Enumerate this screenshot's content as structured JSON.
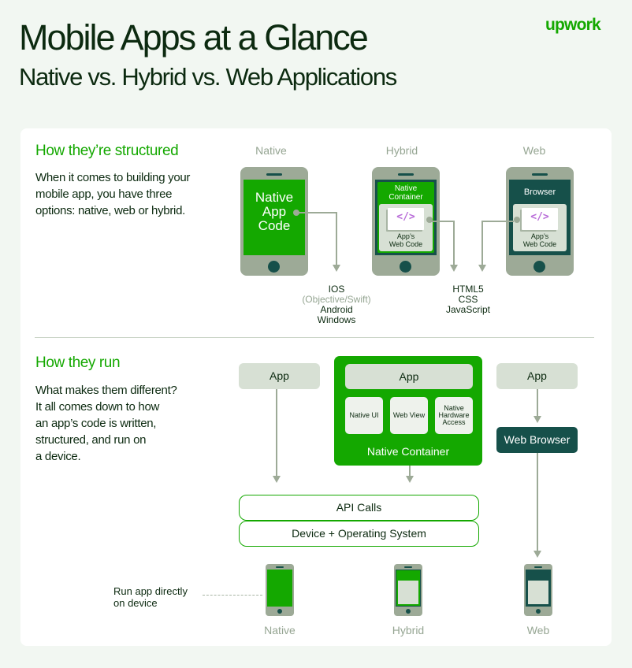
{
  "header": {
    "title": "Mobile Apps at a Glance",
    "subtitle": "Native vs. Hybrid vs. Web Applications",
    "logo": "upwork"
  },
  "colors": {
    "brand_green": "#14a800",
    "dark_teal": "#16504a",
    "phone_gray": "#9daa97",
    "light_gray": "#d7e0d4",
    "background": "#f2f7f2",
    "code_purple": "#b86bd8"
  },
  "structured": {
    "heading": "How they’re structured",
    "text_lines": [
      "When it comes to building your",
      "mobile app, you have three",
      "options: native, web or hybrid."
    ],
    "columns": [
      {
        "label": "Native",
        "screen_text": [
          "Native",
          "App",
          "Code"
        ],
        "icon": "phone-icon"
      },
      {
        "label": "Hybrid",
        "screen_text": [
          "Native",
          "Container"
        ],
        "code_label": [
          "App’s",
          "Web Code"
        ],
        "icon": "phone-icon"
      },
      {
        "label": "Web",
        "screen_text": [
          "Browser"
        ],
        "code_label": [
          "App’s",
          "Web Code"
        ],
        "icon": "phone-icon"
      }
    ],
    "code_glyph": "</>",
    "native_tech": {
      "lines": [
        "IOS",
        "(Objective/Swift)",
        "Android",
        "Windows"
      ]
    },
    "web_tech": {
      "lines": [
        "HTML5",
        "CSS",
        "JavaScript"
      ]
    }
  },
  "run": {
    "heading": "How they run",
    "text_lines": [
      "What makes them different?",
      "It all comes down to how",
      "an app’s code is written,",
      "structured, and run on",
      "a device."
    ],
    "native_app": "App",
    "hybrid_app": "App",
    "hybrid_modules": [
      {
        "label": "Native UI"
      },
      {
        "label": "Web View"
      },
      {
        "label": "Native Hardware Access"
      }
    ],
    "native_container": "Native Container",
    "web_app": "App",
    "web_browser": "Web Browser",
    "api_calls": "API Calls",
    "device_os": "Device + Operating System",
    "run_note_lines": [
      "Run app directly",
      "on device"
    ],
    "bottom_labels": [
      "Native",
      "Hybrid",
      "Web"
    ]
  }
}
